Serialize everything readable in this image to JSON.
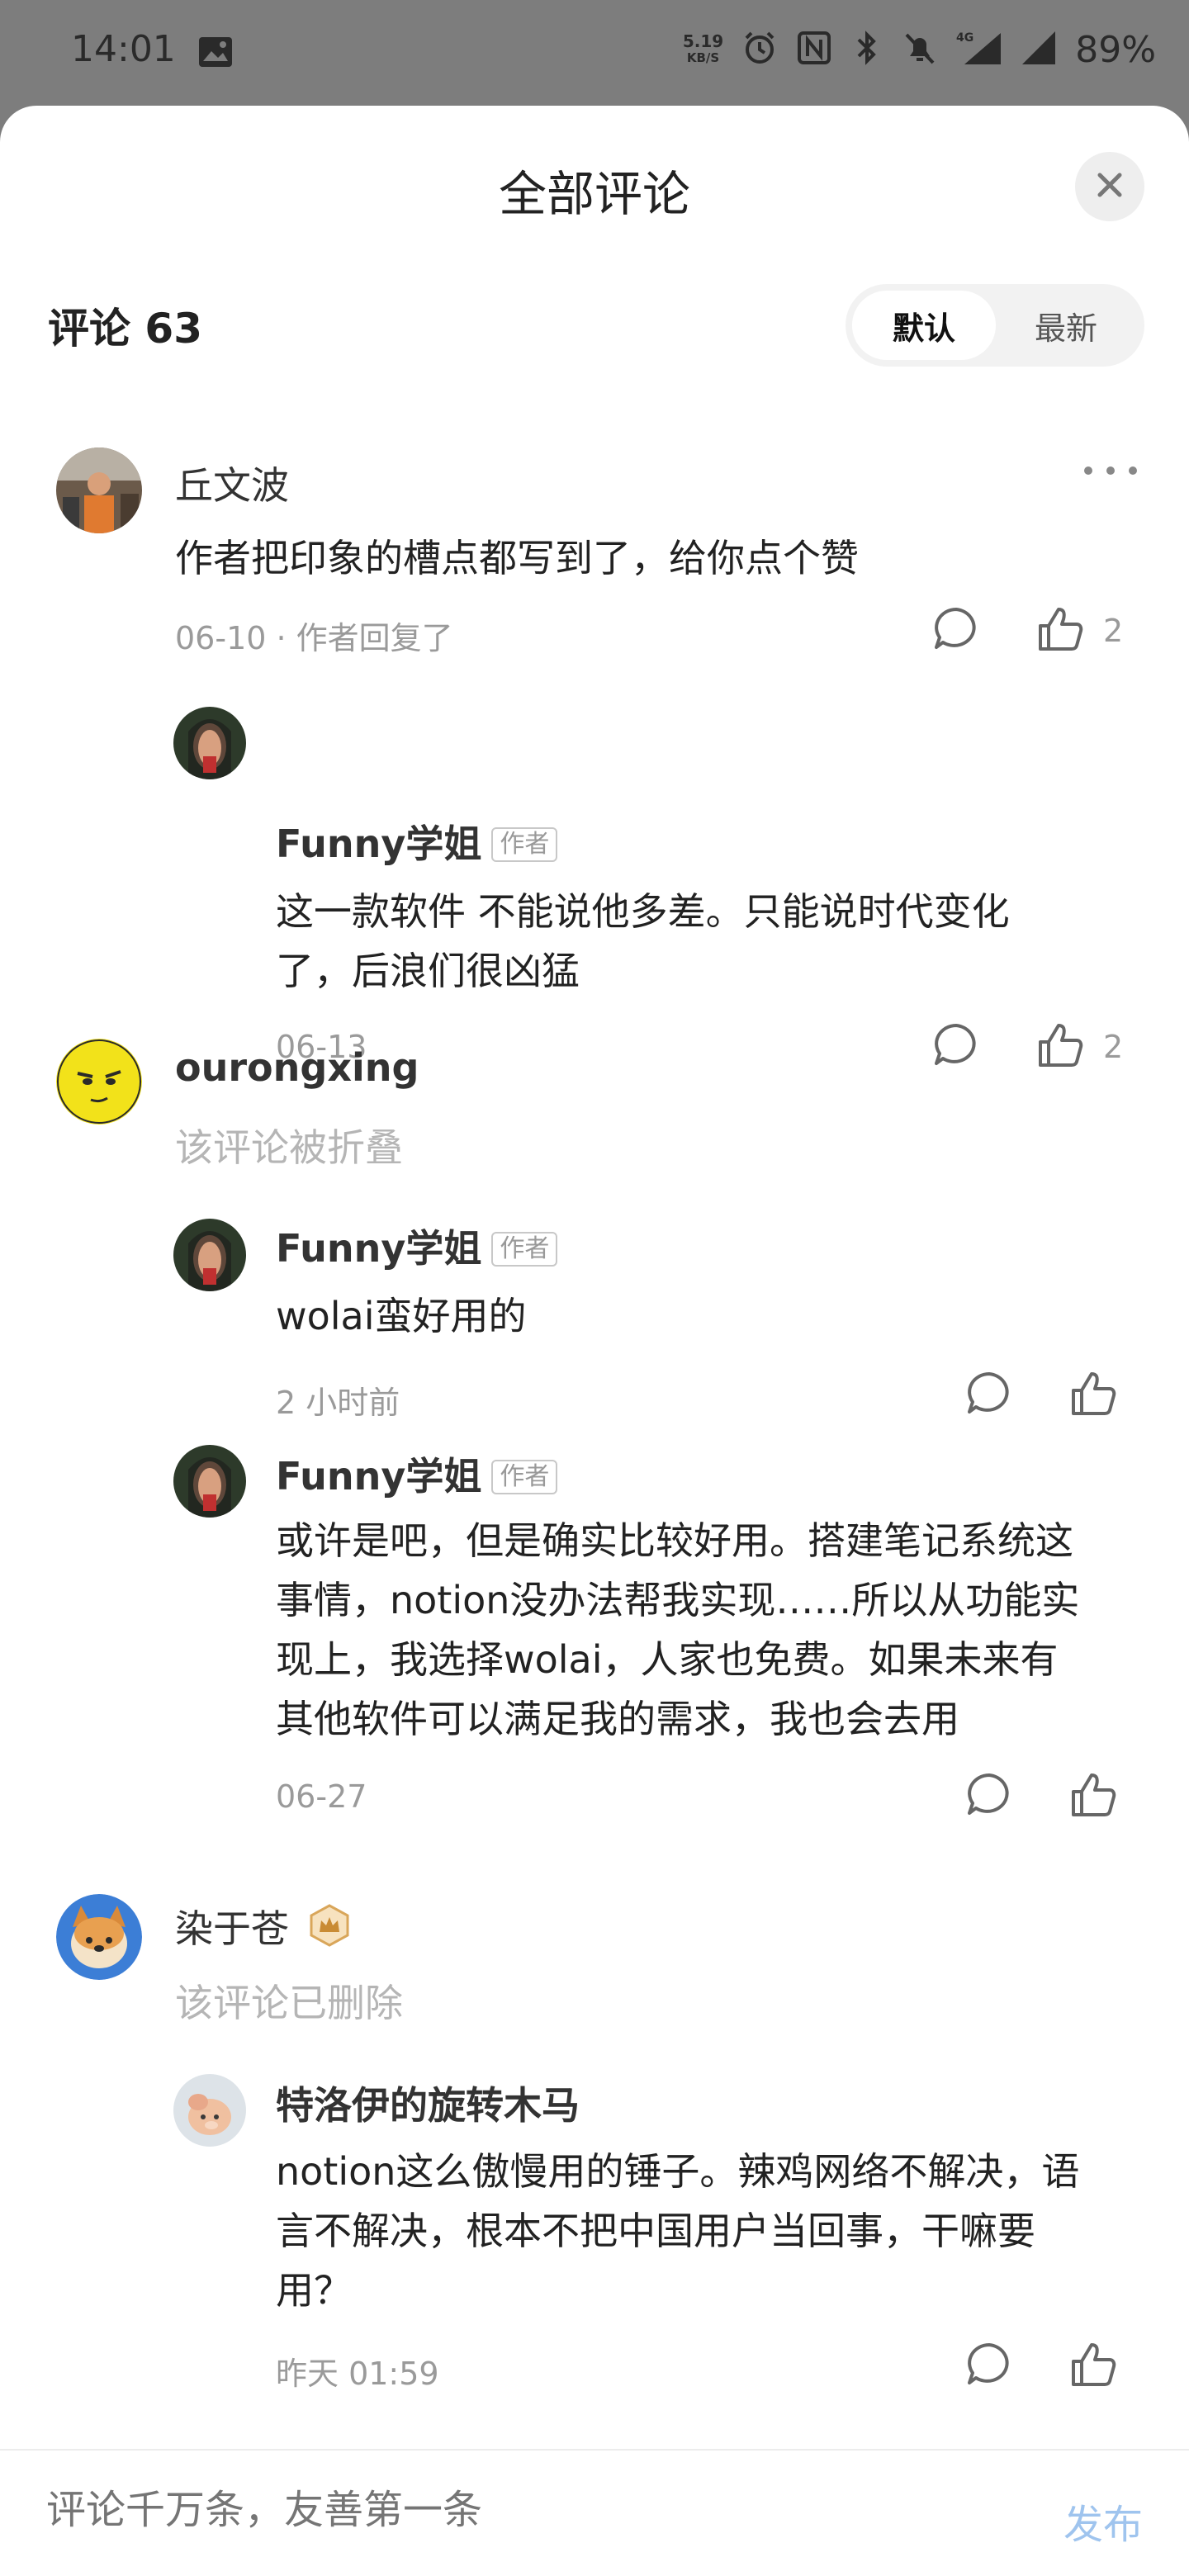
{
  "status_bar": {
    "time": "14:01",
    "net_speed_value": "5.19",
    "net_speed_unit": "KB/S",
    "battery": "89%",
    "network": "4G"
  },
  "sheet": {
    "title": "全部评论",
    "comment_count_label": "评论 63",
    "sort_default": "默认",
    "sort_latest": "最新"
  },
  "comments": [
    {
      "name": "丘文波",
      "text": "作者把印象的槽点都写到了，给你点个赞",
      "meta": "06-10 · 作者回复了",
      "likes": "2",
      "replies": [
        {
          "name": "Funny学姐",
          "tag": "作者",
          "text_line1": "这一款软件 不能说他多差。只能说时代变化",
          "text_line2": "了，后浪们很凶猛",
          "meta": "06-13",
          "likes": "2"
        }
      ]
    },
    {
      "name": "ourongxing",
      "status": "该评论被折叠",
      "replies": [
        {
          "name": "Funny学姐",
          "tag": "作者",
          "text": "wolai蛮好用的",
          "meta": "2 小时前"
        },
        {
          "name": "Funny学姐",
          "tag": "作者",
          "text_line1": "或许是吧，但是确实比较好用。搭建笔记系统这",
          "text_line2": "事情，notion没办法帮我实现……所以从功能实",
          "text_line3": "现上，我选择wolai，人家也免费。如果未来有",
          "text_line4": "其他软件可以满足我的需求，我也会去用",
          "meta": "06-27"
        }
      ]
    },
    {
      "name": "染于苍",
      "status": "该评论已删除",
      "replies": [
        {
          "name": "特洛伊的旋转木马",
          "text_line1": "notion这么傲慢用的锤子。辣鸡网络不解决，语",
          "text_line2": "言不解决，根本不把中国用户当回事，干嘛要",
          "text_line3": "用？",
          "meta": "昨天 01:59"
        }
      ]
    }
  ],
  "input": {
    "placeholder": "评论千万条，友善第一条",
    "publish_label": "发布"
  },
  "colors": {
    "publish": "#9fc4ee",
    "meta": "#9a9a9a",
    "folded": "#b5b5b5"
  }
}
